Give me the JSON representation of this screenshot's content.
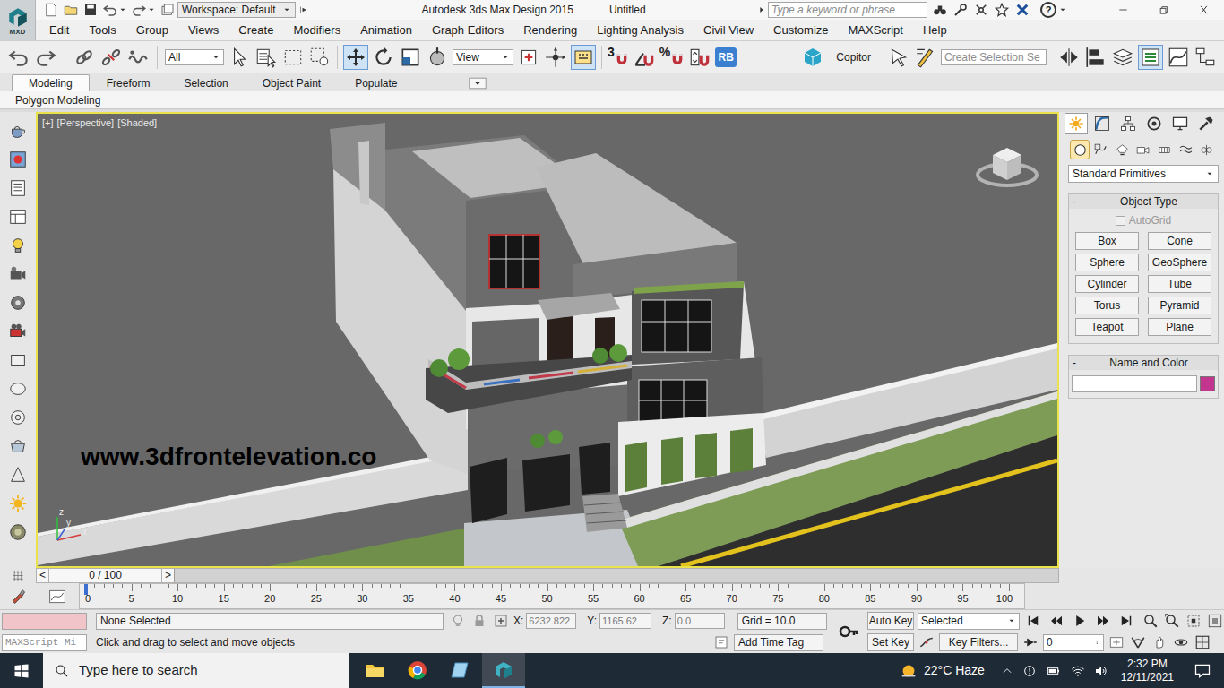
{
  "window": {
    "logo": "MXD",
    "workspace": "Workspace: Default",
    "title": "Autodesk 3ds Max Design 2015",
    "document": "Untitled",
    "search_placeholder": "Type a keyword or phrase",
    "help": "?"
  },
  "menu": [
    "Edit",
    "Tools",
    "Group",
    "Views",
    "Create",
    "Modifiers",
    "Animation",
    "Graph Editors",
    "Rendering",
    "Lighting Analysis",
    "Civil View",
    "Customize",
    "MAXScript",
    "Help"
  ],
  "toolbar": {
    "selection_filter": "All",
    "reference_coordinate_system": "View",
    "snap": "3",
    "percent_snap": "%",
    "rb": "RB",
    "copitor": "Copitor",
    "named_selection_placeholder": "Create Selection Se",
    "toggles": {
      "move": true,
      "keyboard_shortcut_override": true,
      "scene_explorer": true
    }
  },
  "ribbon": {
    "tabs": [
      {
        "label": "Modeling",
        "selected": true
      },
      {
        "label": "Freeform",
        "selected": false
      },
      {
        "label": "Selection",
        "selected": false
      },
      {
        "label": "Object Paint",
        "selected": false
      },
      {
        "label": "Populate",
        "selected": false
      }
    ],
    "panel": "Polygon Modeling"
  },
  "viewport": {
    "labels": [
      "[+]",
      "[Perspective]",
      "[Shaded]"
    ],
    "active": true,
    "watermark": "www.3dfrontelevation.co",
    "axes": {
      "x": "x",
      "y": "y",
      "z": "z"
    }
  },
  "command_panel": {
    "tabs": [
      {
        "selected": true
      },
      {
        "selected": false
      },
      {
        "selected": false
      },
      {
        "selected": false
      },
      {
        "selected": false
      },
      {
        "selected": false
      }
    ],
    "categories": [
      {
        "selected": true
      },
      {
        "selected": false
      },
      {
        "selected": false
      },
      {
        "selected": false
      },
      {
        "selected": false
      },
      {
        "selected": false
      },
      {
        "selected": false
      }
    ],
    "dropdown": "Standard Primitives",
    "object_type": {
      "collapse": "-",
      "title": "Object Type",
      "autogrid": {
        "label": "AutoGrid",
        "checked": false,
        "disabled": true
      },
      "buttons": [
        "Box",
        "Cone",
        "Sphere",
        "GeoSphere",
        "Cylinder",
        "Tube",
        "Torus",
        "Pyramid",
        "Teapot",
        "Plane"
      ]
    },
    "name_and_color": {
      "collapse": "-",
      "title": "Name and Color",
      "name": "",
      "color": "#c2368f"
    }
  },
  "time_slider": {
    "prev": "<",
    "label": "0 / 100",
    "next": ">",
    "level": 0
  },
  "track_bar": {
    "ticks": [
      "0",
      "5",
      "10",
      "15",
      "20",
      "25",
      "30",
      "35",
      "40",
      "45",
      "50",
      "55",
      "60",
      "65",
      "70",
      "75",
      "80",
      "85",
      "90",
      "95",
      "100"
    ]
  },
  "status": {
    "listener_bottom": "MAXScript Mi",
    "selection": "None Selected",
    "x_label": "X:",
    "x": "6232.822",
    "y_label": "Y:",
    "y": "1165.62",
    "z_label": "Z:",
    "z": "0.0",
    "grid": "Grid = 10.0",
    "prompt": "Click and drag to select and move objects",
    "add_time_tag": "Add Time Tag",
    "auto_key": "Auto Key",
    "set_key": "Set Key",
    "key_mode": "Selected",
    "key_filters": "Key Filters...",
    "frame": "0"
  },
  "taskbar": {
    "search_placeholder": "Type here to search",
    "apps": [
      {
        "selected": false
      },
      {
        "selected": false
      },
      {
        "selected": false
      },
      {
        "selected": true
      }
    ],
    "weather": "22°C Haze",
    "time": "2:32 PM",
    "date": "12/11/2021"
  }
}
